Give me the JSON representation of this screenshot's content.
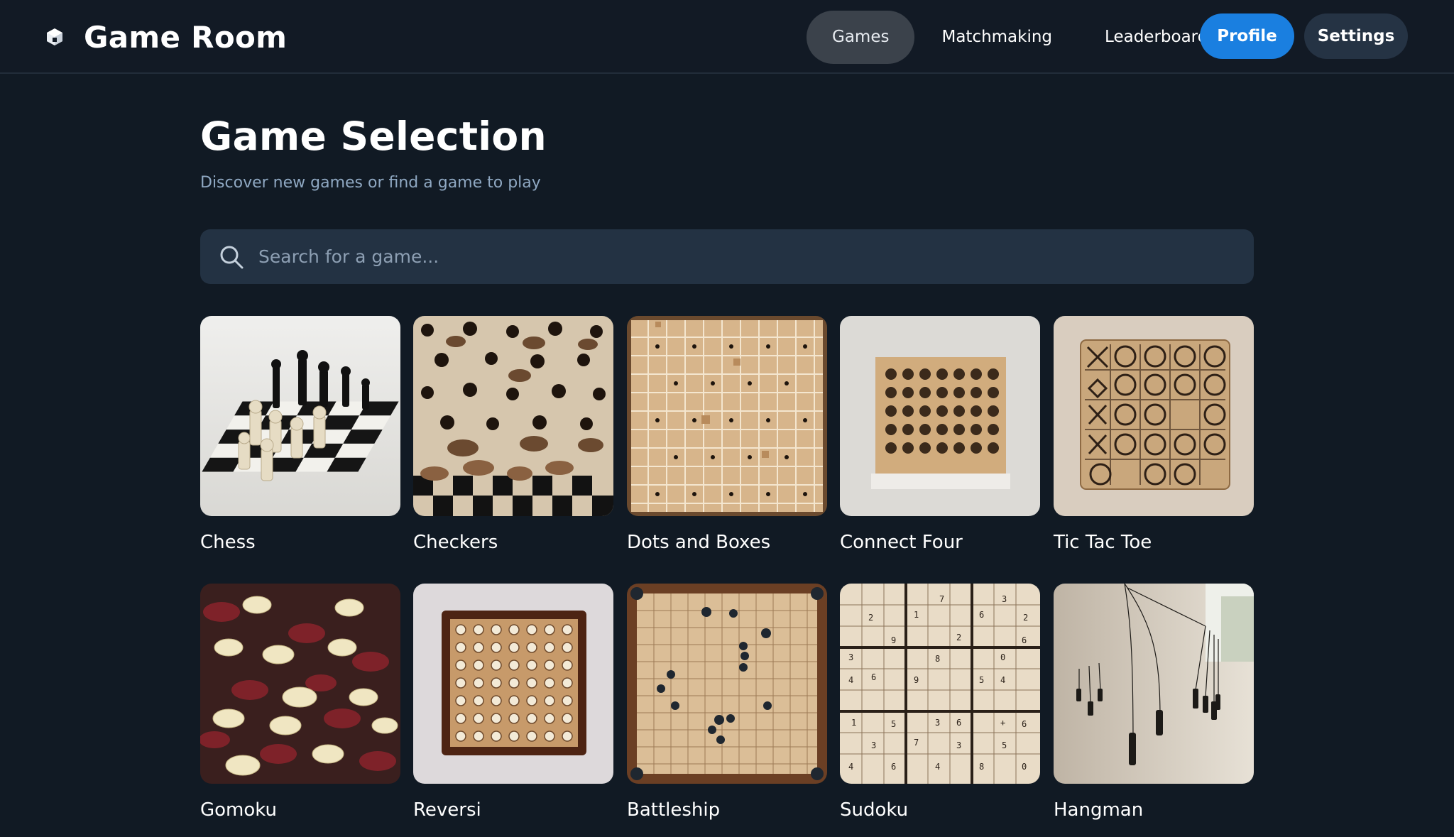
{
  "app": {
    "title": "Game Room",
    "brand_icon": "cube-icon"
  },
  "nav": {
    "items": [
      {
        "label": "Games",
        "active": true
      },
      {
        "label": "Matchmaking",
        "active": false
      },
      {
        "label": "Leaderboard",
        "active": false
      }
    ],
    "profile_label": "Profile",
    "settings_label": "Settings"
  },
  "main": {
    "title": "Game Selection",
    "subtitle": "Discover new games or find a game to play",
    "search": {
      "placeholder": "Search for a game...",
      "value": "",
      "icon": "search-icon"
    },
    "games": [
      {
        "name": "Chess",
        "icon": "chess-board-image"
      },
      {
        "name": "Checkers",
        "icon": "checkers-pieces-image"
      },
      {
        "name": "Dots and Boxes",
        "icon": "dots-grid-image"
      },
      {
        "name": "Connect Four",
        "icon": "connect-four-board-image"
      },
      {
        "name": "Tic Tac Toe",
        "icon": "tic-tac-toe-board-image"
      },
      {
        "name": "Gomoku",
        "icon": "gomoku-stones-image"
      },
      {
        "name": "Reversi",
        "icon": "reversi-board-image"
      },
      {
        "name": "Battleship",
        "icon": "battleship-grid-image"
      },
      {
        "name": "Sudoku",
        "icon": "sudoku-grid-image"
      },
      {
        "name": "Hangman",
        "icon": "hangman-figures-image"
      }
    ]
  },
  "colors": {
    "background": "#111a24",
    "accent": "#1a7fe0",
    "nav_active": "#3b424b",
    "search_bg": "#233243",
    "subtitle": "#8fa8c2"
  }
}
